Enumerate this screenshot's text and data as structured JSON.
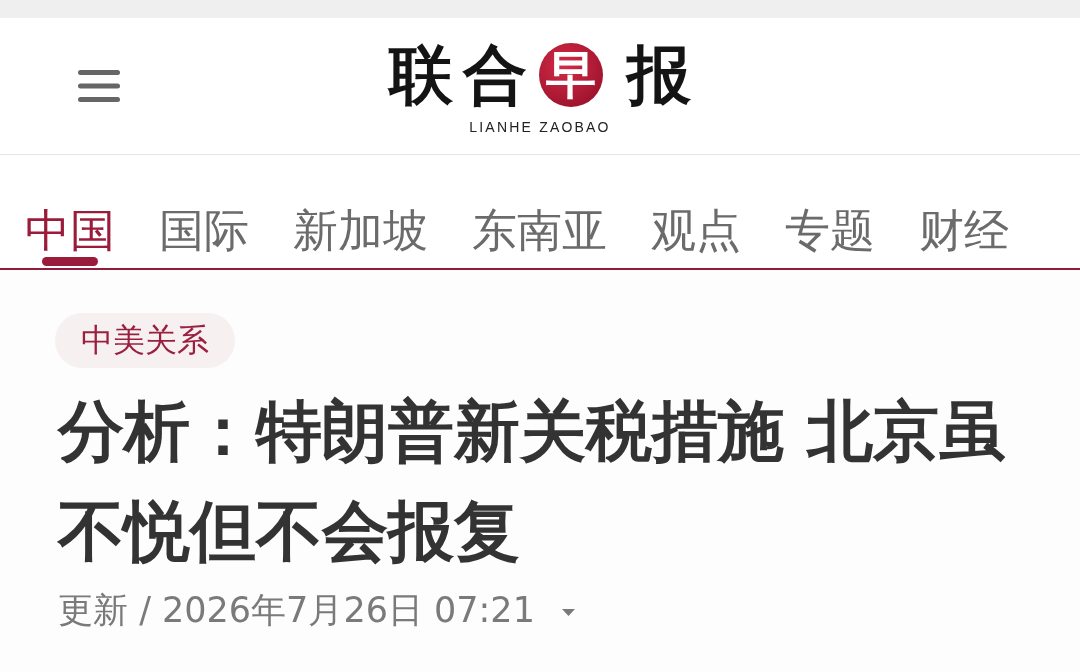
{
  "header": {
    "logo": {
      "characters": [
        {
          "text": "联",
          "kind": "brush"
        },
        {
          "text": "合",
          "kind": "brush"
        },
        {
          "text": "早",
          "kind": "seal"
        },
        {
          "text": "报",
          "kind": "brush"
        }
      ],
      "subtitle": "LIANHE ZAOBAO"
    }
  },
  "tabs": [
    {
      "label": "中国",
      "selected": true
    },
    {
      "label": "国际",
      "selected": false
    },
    {
      "label": "新加坡",
      "selected": false
    },
    {
      "label": "东南亚",
      "selected": false
    },
    {
      "label": "观点",
      "selected": false
    },
    {
      "label": "专题",
      "selected": false
    },
    {
      "label": "财经",
      "selected": false
    }
  ],
  "article": {
    "tag": "中美关系",
    "headline": "分析：特朗普新关税措施 北京虽不悦但不会报复",
    "updated": "更新 / 2026年7月26日 07:21"
  }
}
